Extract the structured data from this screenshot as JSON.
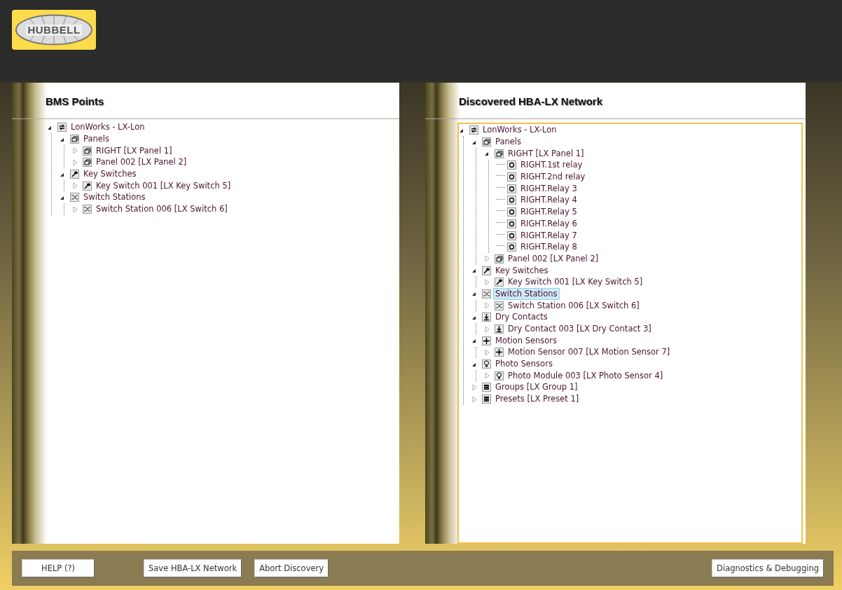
{
  "logo": {
    "text": "HUBBELL"
  },
  "panels": [
    {
      "title": "BMS Points",
      "focused": false,
      "tree": [
        {
          "label": "LonWorks - LX-Lon",
          "kind": "network",
          "expanded": true,
          "selected": false,
          "children": [
            {
              "label": "Panels",
              "kind": "panel",
              "expanded": true,
              "selected": false,
              "children": [
                {
                  "label": "RIGHT [LX Panel 1]",
                  "kind": "panel",
                  "expanded": false,
                  "selected": false
                },
                {
                  "label": "Panel 002 [LX Panel 2]",
                  "kind": "panel",
                  "expanded": false,
                  "selected": false
                }
              ]
            },
            {
              "label": "Key Switches",
              "kind": "key",
              "expanded": true,
              "selected": false,
              "children": [
                {
                  "label": "Key Switch 001 [LX Key Switch 5]",
                  "kind": "key",
                  "expanded": false,
                  "selected": false
                }
              ]
            },
            {
              "label": "Switch Stations",
              "kind": "shuffle",
              "expanded": true,
              "selected": false,
              "children": [
                {
                  "label": "Switch Station 006 [LX Switch 6]",
                  "kind": "shuffle",
                  "expanded": false,
                  "selected": false
                }
              ]
            }
          ]
        }
      ]
    },
    {
      "title": "Discovered HBA-LX Network",
      "focused": true,
      "tree": [
        {
          "label": "LonWorks - LX-Lon",
          "kind": "network",
          "expanded": true,
          "selected": false,
          "children": [
            {
              "label": "Panels",
              "kind": "panel",
              "expanded": true,
              "selected": false,
              "children": [
                {
                  "label": "RIGHT [LX Panel 1]",
                  "kind": "panel",
                  "expanded": true,
                  "selected": false,
                  "children": [
                    {
                      "label": "RIGHT.1st relay",
                      "kind": "relay",
                      "selected": false
                    },
                    {
                      "label": "RIGHT.2nd relay",
                      "kind": "relay",
                      "selected": false
                    },
                    {
                      "label": "RIGHT.Relay 3",
                      "kind": "relay",
                      "selected": false
                    },
                    {
                      "label": "RIGHT.Relay 4",
                      "kind": "relay",
                      "selected": false
                    },
                    {
                      "label": "RIGHT.Relay 5",
                      "kind": "relay",
                      "selected": false
                    },
                    {
                      "label": "RIGHT.Relay 6",
                      "kind": "relay",
                      "selected": false
                    },
                    {
                      "label": "RIGHT.Relay 7",
                      "kind": "relay",
                      "selected": false
                    },
                    {
                      "label": "RIGHT.Relay 8",
                      "kind": "relay",
                      "selected": false
                    }
                  ]
                },
                {
                  "label": "Panel 002 [LX Panel 2]",
                  "kind": "panel",
                  "expanded": false,
                  "selected": false
                }
              ]
            },
            {
              "label": "Key Switches",
              "kind": "key",
              "expanded": true,
              "selected": false,
              "children": [
                {
                  "label": "Key Switch 001 [LX Key Switch 5]",
                  "kind": "key",
                  "expanded": false,
                  "selected": false
                }
              ]
            },
            {
              "label": "Switch Stations",
              "kind": "shuffle",
              "expanded": true,
              "selected": true,
              "children": [
                {
                  "label": "Switch Station 006 [LX Switch 6]",
                  "kind": "shuffle",
                  "expanded": false,
                  "selected": false
                }
              ]
            },
            {
              "label": "Dry Contacts",
              "kind": "contact",
              "expanded": true,
              "selected": false,
              "children": [
                {
                  "label": "Dry Contact 003 [LX Dry Contact 3]",
                  "kind": "contact",
                  "expanded": false,
                  "selected": false
                }
              ]
            },
            {
              "label": "Motion Sensors",
              "kind": "motion",
              "expanded": true,
              "selected": false,
              "children": [
                {
                  "label": "Motion Sensor 007 [LX Motion Sensor 7]",
                  "kind": "motion",
                  "expanded": false,
                  "selected": false
                }
              ]
            },
            {
              "label": "Photo Sensors",
              "kind": "photo",
              "expanded": true,
              "selected": false,
              "children": [
                {
                  "label": "Photo Module 003 [LX Photo Sensor 4]",
                  "kind": "photo",
                  "expanded": false,
                  "selected": false
                }
              ]
            },
            {
              "label": "Groups [LX Group 1]",
              "kind": "grid",
              "expanded": false,
              "selected": false
            },
            {
              "label": "Presets [LX Preset 1]",
              "kind": "grid",
              "expanded": false,
              "selected": false
            }
          ]
        }
      ]
    }
  ],
  "buttons": [
    {
      "label": "HELP (?)"
    },
    {
      "label": "Save HBA-LX Network"
    },
    {
      "label": "Abort Discovery"
    },
    {
      "label": "Diagnostics & Debugging"
    }
  ]
}
